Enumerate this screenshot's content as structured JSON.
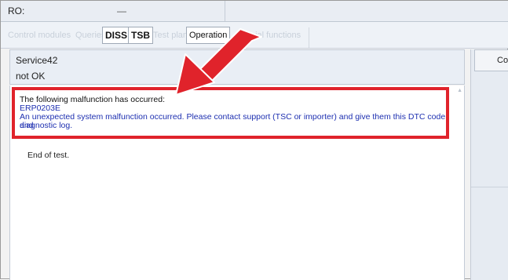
{
  "ro": {
    "label": "RO:",
    "value": "—"
  },
  "tabs": [
    {
      "label": "Control modules",
      "state": "dim"
    },
    {
      "label": "Queries",
      "state": "dim"
    },
    {
      "label": "DISS",
      "state": "active"
    },
    {
      "label": "TSB",
      "state": "active"
    },
    {
      "label": "Test plan",
      "state": "dim"
    },
    {
      "label": "Operation",
      "state": "selected"
    },
    {
      "label": "Special functions",
      "state": "dim"
    }
  ],
  "service": {
    "name": "Service42",
    "status": "not OK"
  },
  "error": {
    "title": "The following malfunction has occurred:",
    "code": "ERP0203E",
    "message_line1": "An unexpected system malfunction occurred. Please contact support (TSC or importer) and give them this DTC code and",
    "message_line2": "diagnostic log."
  },
  "end_test": "End of test.",
  "right_panel": {
    "button_label": "Con"
  },
  "colors": {
    "error_border": "#e0232b",
    "error_text": "#1d2fb0",
    "arrow": "#e0232b"
  },
  "icons": {
    "callout": "red-arrow-icon",
    "scroll": "scroll-up-arrow-icon"
  }
}
